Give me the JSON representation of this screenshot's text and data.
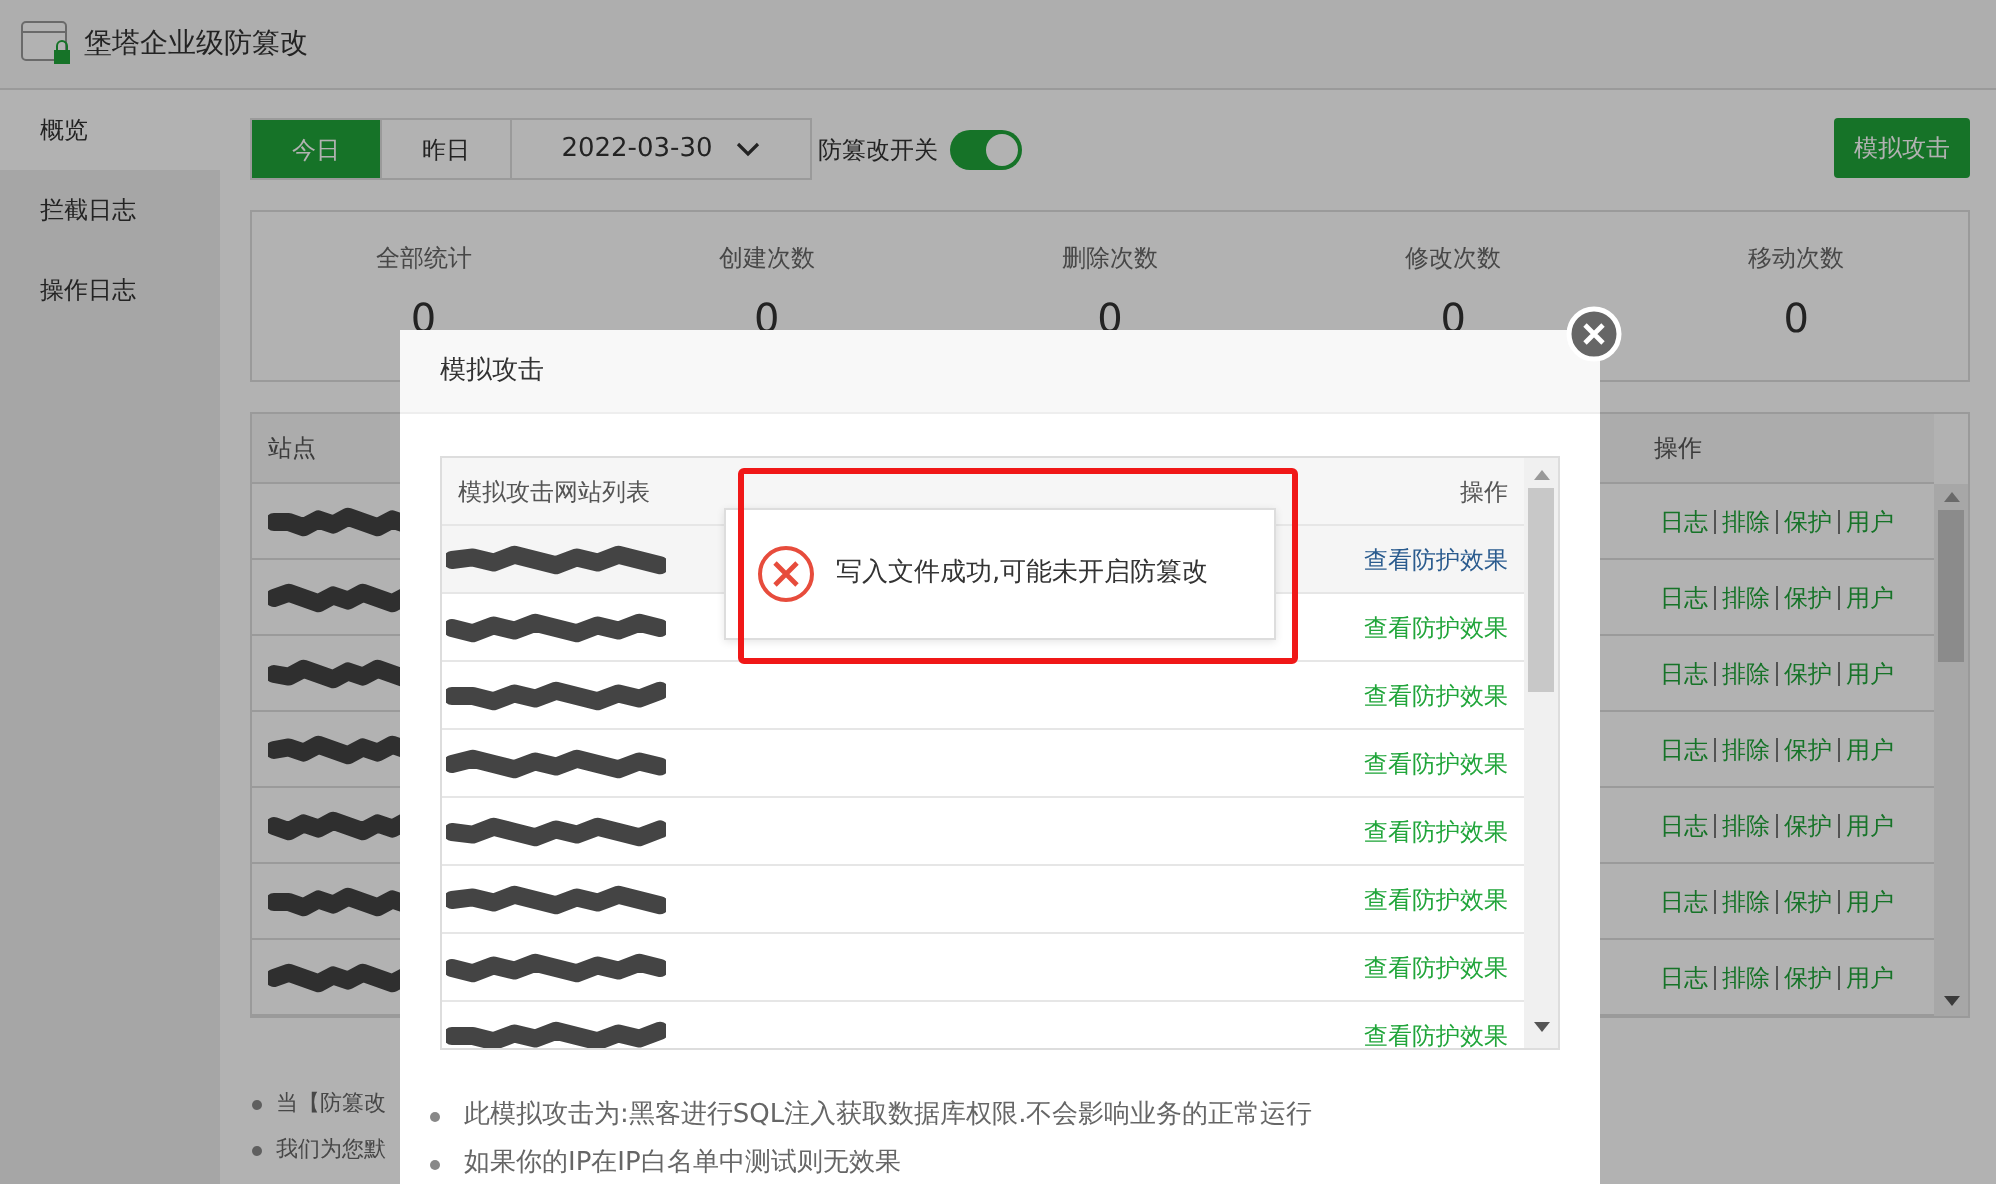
{
  "window": {
    "title": "堡塔企业级防篡改"
  },
  "sidebar": {
    "items": [
      {
        "label": "概览",
        "selected": true
      },
      {
        "label": "拦截日志",
        "selected": false
      },
      {
        "label": "操作日志",
        "selected": false
      }
    ]
  },
  "toolbar": {
    "day_tabs": [
      {
        "label": "今日",
        "selected": true
      },
      {
        "label": "昨日",
        "selected": false
      }
    ],
    "date": "2022-03-30",
    "switch": {
      "label": "防篡改开关",
      "on": true
    },
    "button": "模拟攻击"
  },
  "stats": [
    {
      "label": "全部统计",
      "value": "0"
    },
    {
      "label": "创建次数",
      "value": "0"
    },
    {
      "label": "删除次数",
      "value": "0"
    },
    {
      "label": "修改次数",
      "value": "0"
    },
    {
      "label": "移动次数",
      "value": "0"
    }
  ],
  "sites_table": {
    "columns": [
      "站点",
      "操作"
    ],
    "rows": [
      {
        "actions": [
          "日志",
          "排除",
          "保护",
          "用户"
        ]
      },
      {
        "actions": [
          "日志",
          "排除",
          "保护",
          "用户"
        ]
      },
      {
        "actions": [
          "日志",
          "排除",
          "保护",
          "用户"
        ]
      },
      {
        "actions": [
          "日志",
          "排除",
          "保护",
          "用户"
        ]
      },
      {
        "actions": [
          "日志",
          "排除",
          "保护",
          "用户"
        ]
      },
      {
        "actions": [
          "日志",
          "排除",
          "保护",
          "用户"
        ]
      },
      {
        "actions": [
          "日志",
          "排除",
          "保护",
          "用户"
        ]
      }
    ]
  },
  "notes": [
    "当【防篡改",
    "我们为您默"
  ],
  "modal": {
    "title": "模拟攻击",
    "list_title": "模拟攻击网站列表",
    "action_column": "操作",
    "rows": [
      {
        "link": "查看防护效果",
        "hovered": true
      },
      {
        "link": "查看防护效果",
        "hovered": false
      },
      {
        "link": "查看防护效果",
        "hovered": false
      },
      {
        "link": "查看防护效果",
        "hovered": false
      },
      {
        "link": "查看防护效果",
        "hovered": false
      },
      {
        "link": "查看防护效果",
        "hovered": false
      },
      {
        "link": "查看防护效果",
        "hovered": false
      },
      {
        "link": "查看防护效果",
        "hovered": false
      }
    ],
    "notes": [
      "此模拟攻击为:黑客进行SQL注入获取数据库权限.不会影响业务的正常运行",
      "如果你的IP在IP白名单中测试则无效果"
    ]
  },
  "toast": {
    "kind": "error",
    "message": "写入文件成功,可能未开启防篡改"
  }
}
